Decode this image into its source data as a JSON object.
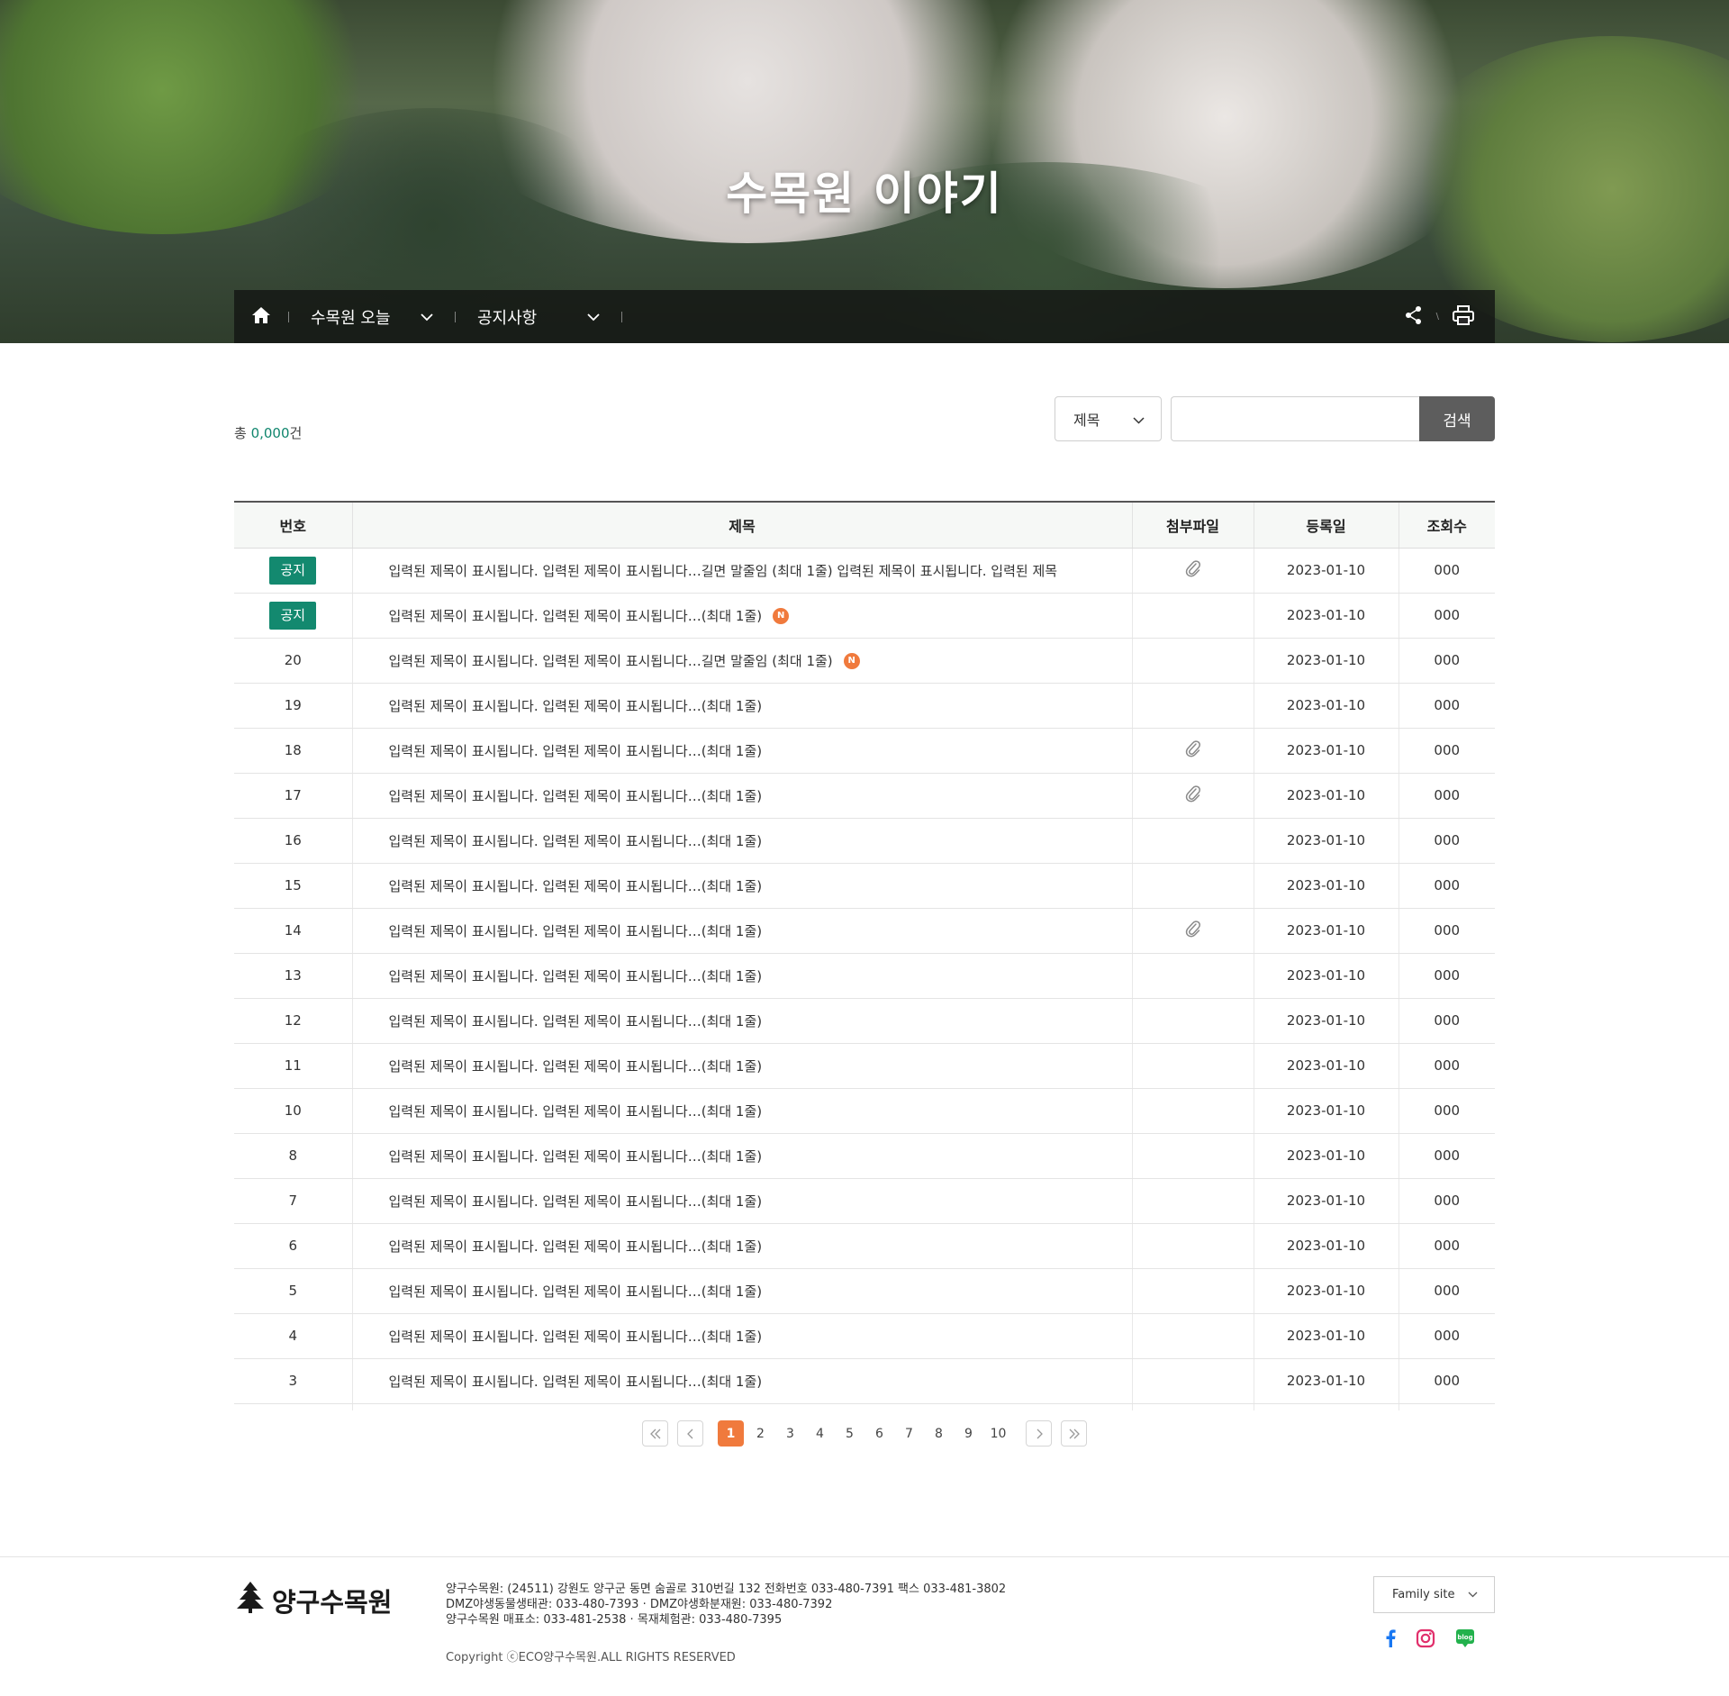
{
  "hero": {
    "title": "수목원 이야기"
  },
  "nav": {
    "depth1": "수목원 오늘",
    "depth2": "공지사항"
  },
  "icons": {
    "home": "home-icon",
    "share": "share-icon",
    "print": "print-icon",
    "attach": "paperclip-icon",
    "chevron": "chevron-down-icon"
  },
  "toolbar": {
    "total_prefix": "총 ",
    "total_count": "0,000",
    "total_suffix": "건",
    "select_value": "제목",
    "search_button": "검색"
  },
  "table": {
    "headers": [
      "번호",
      "제목",
      "첨부파일",
      "등록일",
      "조회수"
    ],
    "rows": [
      {
        "num": "공지",
        "notice": true,
        "title": "입력된 제목이 표시됩니다. 입력된 제목이 표시됩니다…길면 말줄임 (최대 1줄)  입력된 제목이 표시됩니다. 입력된 제목",
        "attach": true,
        "isNew": false,
        "date": "2023-01-10",
        "views": "000"
      },
      {
        "num": "공지",
        "notice": true,
        "title": "입력된 제목이 표시됩니다. 입력된 제목이 표시됩니다…(최대 1줄)",
        "attach": false,
        "isNew": true,
        "date": "2023-01-10",
        "views": "000"
      },
      {
        "num": "20",
        "notice": false,
        "title": "입력된 제목이 표시됩니다. 입력된 제목이 표시됩니다…길면 말줄임 (최대 1줄)",
        "attach": false,
        "isNew": true,
        "date": "2023-01-10",
        "views": "000"
      },
      {
        "num": "19",
        "notice": false,
        "title": "입력된 제목이 표시됩니다. 입력된 제목이 표시됩니다…(최대 1줄)",
        "attach": false,
        "isNew": false,
        "date": "2023-01-10",
        "views": "000"
      },
      {
        "num": "18",
        "notice": false,
        "title": "입력된 제목이 표시됩니다. 입력된 제목이 표시됩니다…(최대 1줄)",
        "attach": true,
        "isNew": false,
        "date": "2023-01-10",
        "views": "000"
      },
      {
        "num": "17",
        "notice": false,
        "title": "입력된 제목이 표시됩니다. 입력된 제목이 표시됩니다…(최대 1줄)",
        "attach": true,
        "isNew": false,
        "date": "2023-01-10",
        "views": "000"
      },
      {
        "num": "16",
        "notice": false,
        "title": "입력된 제목이 표시됩니다. 입력된 제목이 표시됩니다…(최대 1줄)",
        "attach": false,
        "isNew": false,
        "date": "2023-01-10",
        "views": "000"
      },
      {
        "num": "15",
        "notice": false,
        "title": "입력된 제목이 표시됩니다. 입력된 제목이 표시됩니다…(최대 1줄)",
        "attach": false,
        "isNew": false,
        "date": "2023-01-10",
        "views": "000"
      },
      {
        "num": "14",
        "notice": false,
        "title": "입력된 제목이 표시됩니다. 입력된 제목이 표시됩니다…(최대 1줄)",
        "attach": true,
        "isNew": false,
        "date": "2023-01-10",
        "views": "000"
      },
      {
        "num": "13",
        "notice": false,
        "title": "입력된 제목이 표시됩니다. 입력된 제목이 표시됩니다…(최대 1줄)",
        "attach": false,
        "isNew": false,
        "date": "2023-01-10",
        "views": "000"
      },
      {
        "num": "12",
        "notice": false,
        "title": "입력된 제목이 표시됩니다. 입력된 제목이 표시됩니다…(최대 1줄)",
        "attach": false,
        "isNew": false,
        "date": "2023-01-10",
        "views": "000"
      },
      {
        "num": "11",
        "notice": false,
        "title": "입력된 제목이 표시됩니다. 입력된 제목이 표시됩니다…(최대 1줄)",
        "attach": false,
        "isNew": false,
        "date": "2023-01-10",
        "views": "000"
      },
      {
        "num": "10",
        "notice": false,
        "title": "입력된 제목이 표시됩니다. 입력된 제목이 표시됩니다…(최대 1줄)",
        "attach": false,
        "isNew": false,
        "date": "2023-01-10",
        "views": "000"
      },
      {
        "num": "8",
        "notice": false,
        "title": "입력된 제목이 표시됩니다. 입력된 제목이 표시됩니다…(최대 1줄)",
        "attach": false,
        "isNew": false,
        "date": "2023-01-10",
        "views": "000"
      },
      {
        "num": "7",
        "notice": false,
        "title": "입력된 제목이 표시됩니다. 입력된 제목이 표시됩니다…(최대 1줄)",
        "attach": false,
        "isNew": false,
        "date": "2023-01-10",
        "views": "000"
      },
      {
        "num": "6",
        "notice": false,
        "title": "입력된 제목이 표시됩니다. 입력된 제목이 표시됩니다…(최대 1줄)",
        "attach": false,
        "isNew": false,
        "date": "2023-01-10",
        "views": "000"
      },
      {
        "num": "5",
        "notice": false,
        "title": "입력된 제목이 표시됩니다. 입력된 제목이 표시됩니다…(최대 1줄)",
        "attach": false,
        "isNew": false,
        "date": "2023-01-10",
        "views": "000"
      },
      {
        "num": "4",
        "notice": false,
        "title": "입력된 제목이 표시됩니다. 입력된 제목이 표시됩니다…(최대 1줄)",
        "attach": false,
        "isNew": false,
        "date": "2023-01-10",
        "views": "000"
      },
      {
        "num": "3",
        "notice": false,
        "title": "입력된 제목이 표시됩니다. 입력된 제목이 표시됩니다…(최대 1줄)",
        "attach": false,
        "isNew": false,
        "date": "2023-01-10",
        "views": "000"
      }
    ],
    "new_badge": "N"
  },
  "pagination": {
    "pages": [
      "1",
      "2",
      "3",
      "4",
      "5",
      "6",
      "7",
      "8",
      "9",
      "10"
    ],
    "current": "1"
  },
  "footer": {
    "logo_text": "양구수목원",
    "address_lines": [
      "양구수목원: (24511) 강원도 양구군 동면 숨골로 310번길 132 전화번호 033-480-7391 팩스 033-481-3802",
      "DMZ야생동물생태관: 033-480-7393 · DMZ야생화분재원: 033-480-7392",
      "양구수목원 매표소: 033-481-2538 · 목재체험관: 033-480-7395"
    ],
    "copyright": "Copyright ⓒECO양구수목원.ALL RIGHTS RESERVED",
    "family_site": "Family site",
    "blog_label": "blog"
  },
  "colors": {
    "accent_green": "#13896f",
    "accent_orange": "#f07a3d"
  }
}
